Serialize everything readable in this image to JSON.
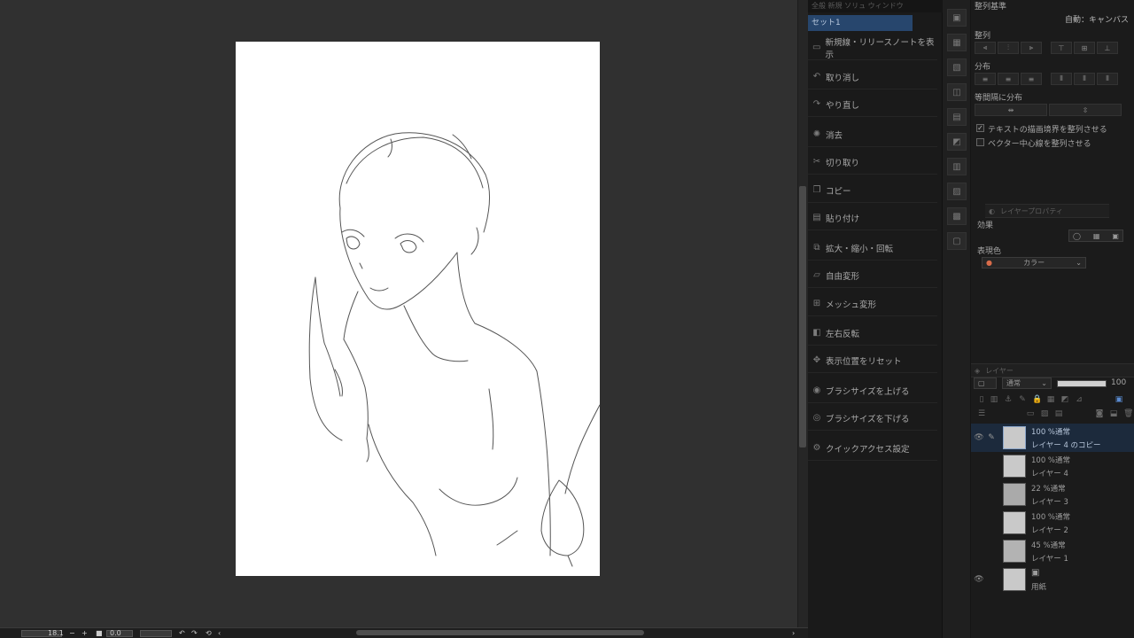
{
  "canvas_status": {
    "zoom": "18.1",
    "rotation": "0.0"
  },
  "quick_access": {
    "header": "全般 新規 ソリュ ウィンドウ",
    "set_name": "セット1",
    "items": [
      {
        "label": "新規線・リリースノートを表示",
        "icon": "news-icon"
      },
      {
        "label": "取り消し",
        "icon": "undo-icon"
      },
      {
        "label": "やり直し",
        "icon": "redo-icon"
      },
      {
        "label": "消去",
        "icon": "erase-icon"
      },
      {
        "label": "切り取り",
        "icon": "cut-icon"
      },
      {
        "label": "コピー",
        "icon": "copy-icon"
      },
      {
        "label": "貼り付け",
        "icon": "paste-icon"
      },
      {
        "label": "拡大・縮小・回転",
        "icon": "scale-icon"
      },
      {
        "label": "自由変形",
        "icon": "free-transform-icon"
      },
      {
        "label": "メッシュ変形",
        "icon": "mesh-icon"
      },
      {
        "label": "左右反転",
        "icon": "flip-icon"
      },
      {
        "label": "表示位置をリセット",
        "icon": "reset-position-icon"
      },
      {
        "label": "ブラシサイズを上げる",
        "icon": "brush-up-icon"
      },
      {
        "label": "ブラシサイズを下げる",
        "icon": "brush-down-icon"
      },
      {
        "label": "クイックアクセス設定",
        "icon": "settings-icon"
      }
    ]
  },
  "align_panel": {
    "title": "整列基準",
    "auto_label": "自動：キャンバス",
    "align_label": "整列",
    "distribute_label": "分布",
    "equal_spacing_label": "等間隔に分布",
    "check_text_bounds": "テキストの描画境界を整列させる",
    "check_text_bounds_value": true,
    "check_vector_center": "ベクター中心線を整列させる",
    "check_vector_center_value": false
  },
  "layer_property": {
    "tab_label": "レイヤープロパティ",
    "effect_label": "効果",
    "expression_color_label": "表現色",
    "expression_color_value": "カラー"
  },
  "layer_panel": {
    "tab_label": "レイヤー",
    "blend_mode": "通常",
    "opacity": "100",
    "layers": [
      {
        "blend": "100 %通常",
        "name": "レイヤー 4 のコピー",
        "visible": true,
        "editing": true,
        "active": true
      },
      {
        "blend": "100 %通常",
        "name": "レイヤー 4",
        "visible": false,
        "editing": false,
        "active": false
      },
      {
        "blend": "22 %通常",
        "name": "レイヤー 3",
        "visible": false,
        "editing": false,
        "active": false
      },
      {
        "blend": "100 %通常",
        "name": "レイヤー 2",
        "visible": false,
        "editing": false,
        "active": false
      },
      {
        "blend": "45 %通常",
        "name": "レイヤー 1",
        "visible": false,
        "editing": false,
        "active": false
      },
      {
        "blend": "",
        "name": "用紙",
        "visible": true,
        "editing": false,
        "active": false
      }
    ]
  },
  "colors": {
    "accent": "#27466d",
    "background": "#2b2b2b",
    "panel": "#1b1b1b",
    "paper": "#ffffff"
  }
}
